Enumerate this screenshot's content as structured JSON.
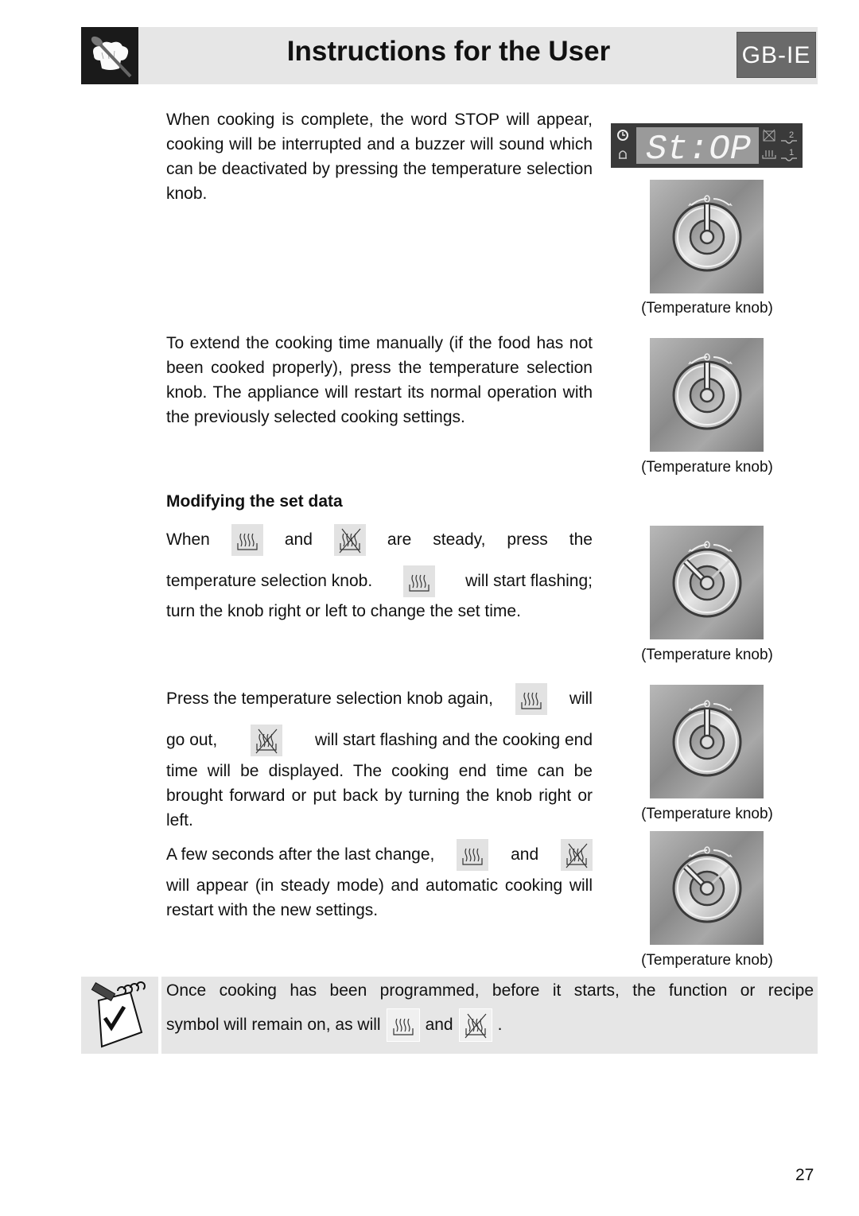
{
  "header": {
    "title": "Instructions for the User",
    "language_badge": "GB-IE",
    "logo_icon": "chef-hat-spoon-icon"
  },
  "display": {
    "text": "St:OP",
    "left_icons": [
      "clock-icon",
      "bell-icon"
    ],
    "right_icons": [
      "no-heat-icon",
      "level-2-icon",
      "heat-icon",
      "level-1-icon"
    ],
    "right_labels": [
      "2",
      "1"
    ]
  },
  "sections": [
    {
      "text": "When cooking is complete, the word STOP will appear, cooking will be interrupted and a buzzer will sound which can be deactivated by pressing the temperature selection knob."
    },
    {
      "text": "To extend the cooking time manually (if the food has not been cooked properly), press the temperature selection knob. The appliance will restart its normal operation with the previously selected cooking settings."
    }
  ],
  "modify": {
    "heading": "Modifying the set data",
    "p1": {
      "line1": [
        "When",
        "and",
        "are",
        "steady,",
        "press",
        "the"
      ],
      "line2a": "temperature selection knob.",
      "line2b": "will start flashing;",
      "line3": "turn the knob right or left to change the set time."
    },
    "p2": {
      "line1a": "Press the temperature selection knob again,",
      "line1b": "will",
      "line2a": "go out,",
      "line2b": "will start flashing and the cooking end",
      "rest": "time will be displayed. The cooking end time can be brought forward or put back by turning the knob right or left."
    },
    "p3": {
      "line1a": "A few seconds after the last change,",
      "line1b": "and",
      "rest": "will appear (in steady mode) and automatic cooking will restart with the new settings."
    }
  },
  "knobs": [
    {
      "caption": "(Temperature knob)",
      "position": "upright"
    },
    {
      "caption": "(Temperature knob)",
      "position": "upright"
    },
    {
      "caption": "(Temperature knob)",
      "position": "turned"
    },
    {
      "caption": "(Temperature knob)",
      "position": "upright"
    },
    {
      "caption": "(Temperature knob)",
      "position": "turned"
    }
  ],
  "note": {
    "icon": "notepad-check-icon",
    "line1": "Once cooking has been programmed, before it starts, the function or recipe",
    "line2a": "symbol will remain on, as will",
    "line2b": "and",
    "line2c": "."
  },
  "page_number": "27"
}
